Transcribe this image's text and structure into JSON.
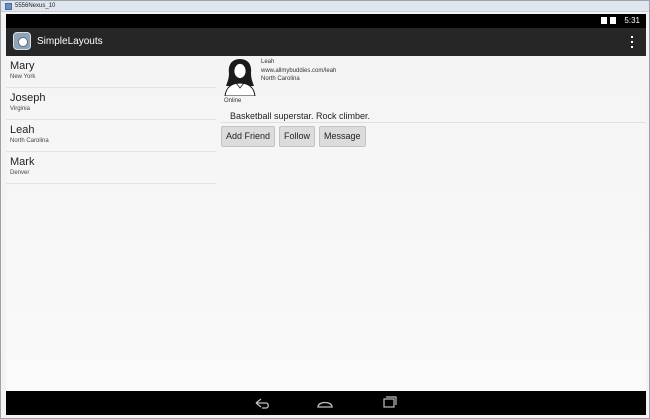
{
  "window": {
    "title": "5556Nexus_10"
  },
  "status_bar": {
    "time": "5:31"
  },
  "action_bar": {
    "title": "SimpleLayouts"
  },
  "contacts": [
    {
      "name": "Mary",
      "location": "New York"
    },
    {
      "name": "Joseph",
      "location": "Virginia"
    },
    {
      "name": "Leah",
      "location": "North Carolina"
    },
    {
      "name": "Mark",
      "location": "Denver"
    }
  ],
  "detail": {
    "name": "Leah",
    "url": "www.allmybuddies.com/leah",
    "location": "North Carolina",
    "status": "Online",
    "bio": "Basketball superstar. Rock climber.",
    "buttons": {
      "add_friend": "Add Friend",
      "follow": "Follow",
      "message": "Message"
    }
  },
  "icons": {
    "app": "app-icon",
    "overflow": "overflow-menu-icon",
    "avatar": "person-avatar-icon",
    "back": "back-icon",
    "home": "home-icon",
    "recents": "recent-apps-icon"
  },
  "colors": {
    "status_bar": "#000000",
    "action_bar": "#262626",
    "content_bg": "#f4f4f4",
    "button_bg": "#dcdcdc"
  }
}
